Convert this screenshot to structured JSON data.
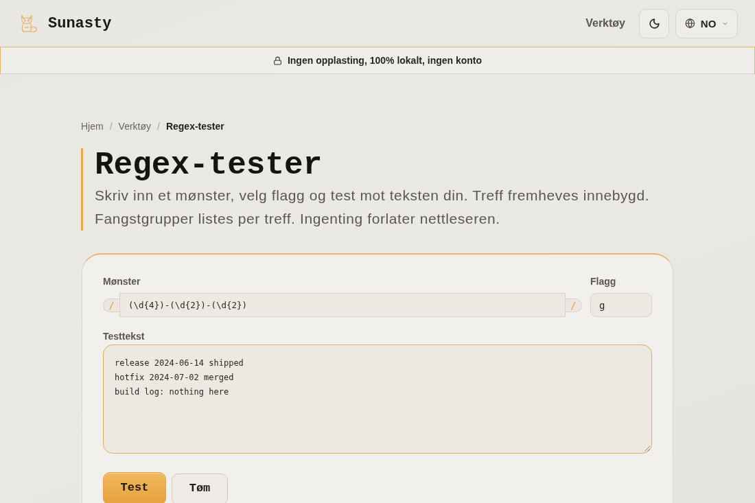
{
  "header": {
    "brand": "Sunasty",
    "nav": [
      {
        "label": "Verktøy"
      }
    ],
    "language": {
      "label": "NO"
    }
  },
  "banner": {
    "text": "Ingen opplasting, 100% lokalt, ingen konto"
  },
  "breadcrumb": {
    "items": [
      {
        "label": "Hjem",
        "current": false
      },
      {
        "label": "Verktøy",
        "current": false
      },
      {
        "label": "Regex-tester",
        "current": true
      }
    ],
    "separators": [
      "/",
      "/"
    ]
  },
  "title": "Regex-tester",
  "description": "Skriv inn et mønster, velg flagg og test mot teksten din. Treff fremheves innebygd. Fangstgrupper listes per treff. Ingenting forlater nettleseren.",
  "form": {
    "pattern": {
      "label": "Mønster",
      "open_delimiter": "/",
      "value": "(\\d{4})-(\\d{2})-(\\d{2})",
      "close_delimiter": "/"
    },
    "flags": {
      "label": "Flagg",
      "value": "g"
    },
    "test_text": {
      "label": "Testtekst",
      "lines": [
        "release 2024-06-14 shipped",
        "hotfix 2024-07-02 merged",
        "build log: nothing here"
      ]
    },
    "buttons": [
      {
        "label": "Test",
        "kind": "primary"
      },
      {
        "label": "Tøm",
        "kind": "secondary"
      }
    ]
  }
}
